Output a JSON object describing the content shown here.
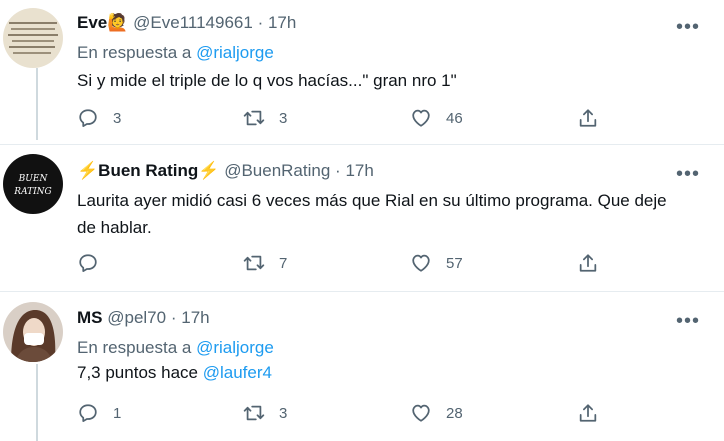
{
  "tweets": [
    {
      "name": "Eve",
      "name_emoji": "🙋",
      "handle": "@Eve11149661",
      "separator": "·",
      "time": "17h",
      "reply_prefix": "En respuesta a",
      "reply_user": "@rialjorge",
      "text": "Si y mide el triple de lo q vos hacías...\" gran nro 1\"",
      "replies": "3",
      "retweets": "3",
      "likes": "46"
    },
    {
      "name_prefix_emoji": "⚡",
      "name": "Buen Rating",
      "name_suffix_emoji": "⚡",
      "handle": "@BuenRating",
      "separator": "·",
      "time": "17h",
      "avatar_text": "BUEN RATING",
      "text": "Laurita ayer midió casi 6 veces más que Rial en su último programa. Que deje de hablar.",
      "replies": "",
      "retweets": "7",
      "likes": "57"
    },
    {
      "name": "MS",
      "handle": "@pel70",
      "separator": "·",
      "time": "17h",
      "reply_prefix": "En respuesta a",
      "reply_user": "@rialjorge",
      "text_prefix": "7,3 puntos hace",
      "text_mention": "@laufer4",
      "replies": "1",
      "retweets": "3",
      "likes": "28"
    }
  ],
  "icons": {
    "reply": "reply-icon",
    "retweet": "retweet-icon",
    "like": "heart-icon",
    "share": "share-icon",
    "more": "more-options-icon"
  },
  "colors": {
    "link": "#1d9bf0",
    "muted": "#536471",
    "divider": "#e6ecf0"
  }
}
